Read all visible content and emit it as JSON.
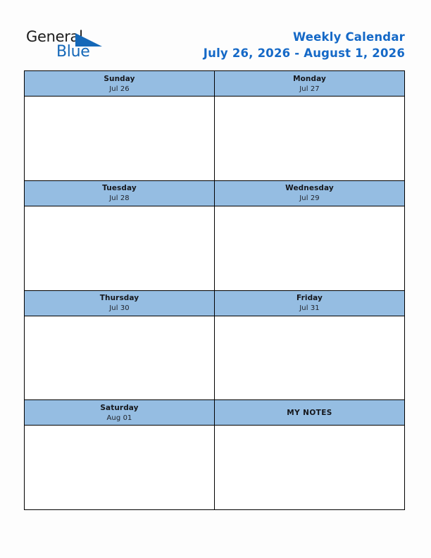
{
  "document": {
    "type": "weekly-calendar",
    "page_background": "#fdfdfd"
  },
  "branding": {
    "logo": {
      "word_one": "General",
      "word_two": "Blue",
      "shape": "right-triangle",
      "accent_color": "#1568b8",
      "text_color": "#1b1b1b"
    }
  },
  "header": {
    "title": "Weekly Calendar",
    "date_range": "July 26, 2026 - August 1, 2026",
    "title_color": "#1569c7"
  },
  "theme": {
    "header_band_color": "#95bde2",
    "border_color": "#000000",
    "cell_background": "#ffffff",
    "day_name_color": "#15171c",
    "day_date_color": "#20242c"
  },
  "weeks": [
    {
      "cells": [
        {
          "name": "Sunday",
          "date": "Jul 26",
          "content": ""
        },
        {
          "name": "Monday",
          "date": "Jul 27",
          "content": ""
        }
      ]
    },
    {
      "cells": [
        {
          "name": "Tuesday",
          "date": "Jul 28",
          "content": ""
        },
        {
          "name": "Wednesday",
          "date": "Jul 29",
          "content": ""
        }
      ]
    },
    {
      "cells": [
        {
          "name": "Thursday",
          "date": "Jul 30",
          "content": ""
        },
        {
          "name": "Friday",
          "date": "Jul 31",
          "content": ""
        }
      ]
    },
    {
      "cells": [
        {
          "name": "Saturday",
          "date": "Aug 01",
          "content": ""
        },
        {
          "name": "MY NOTES",
          "date": "",
          "content": ""
        }
      ]
    }
  ]
}
